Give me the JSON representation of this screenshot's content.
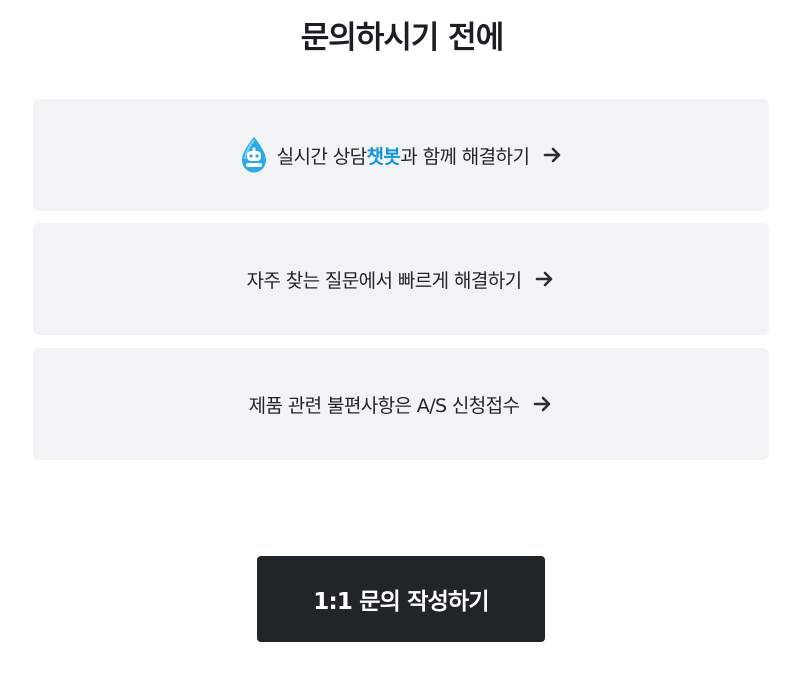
{
  "page": {
    "title": "문의하시기 전에"
  },
  "options": [
    {
      "prefix": "실시간 상담 ",
      "highlight": "챗봇",
      "suffix": "과 함께 해결하기",
      "icon": "chatbot-droplet-icon",
      "highlight_color": "#1495d8"
    },
    {
      "label": "자주 찾는 질문에서 빠르게 해결하기",
      "icon": "arrow-right-icon"
    },
    {
      "label": "제품 관련 불편사항은 A/S 신청접수",
      "icon": "arrow-right-icon"
    }
  ],
  "cta": {
    "label": "1:1 문의 작성하기"
  },
  "colors": {
    "card_background": "#f2f3f5",
    "cta_background": "#1f2528",
    "accent": "#1495d8"
  }
}
